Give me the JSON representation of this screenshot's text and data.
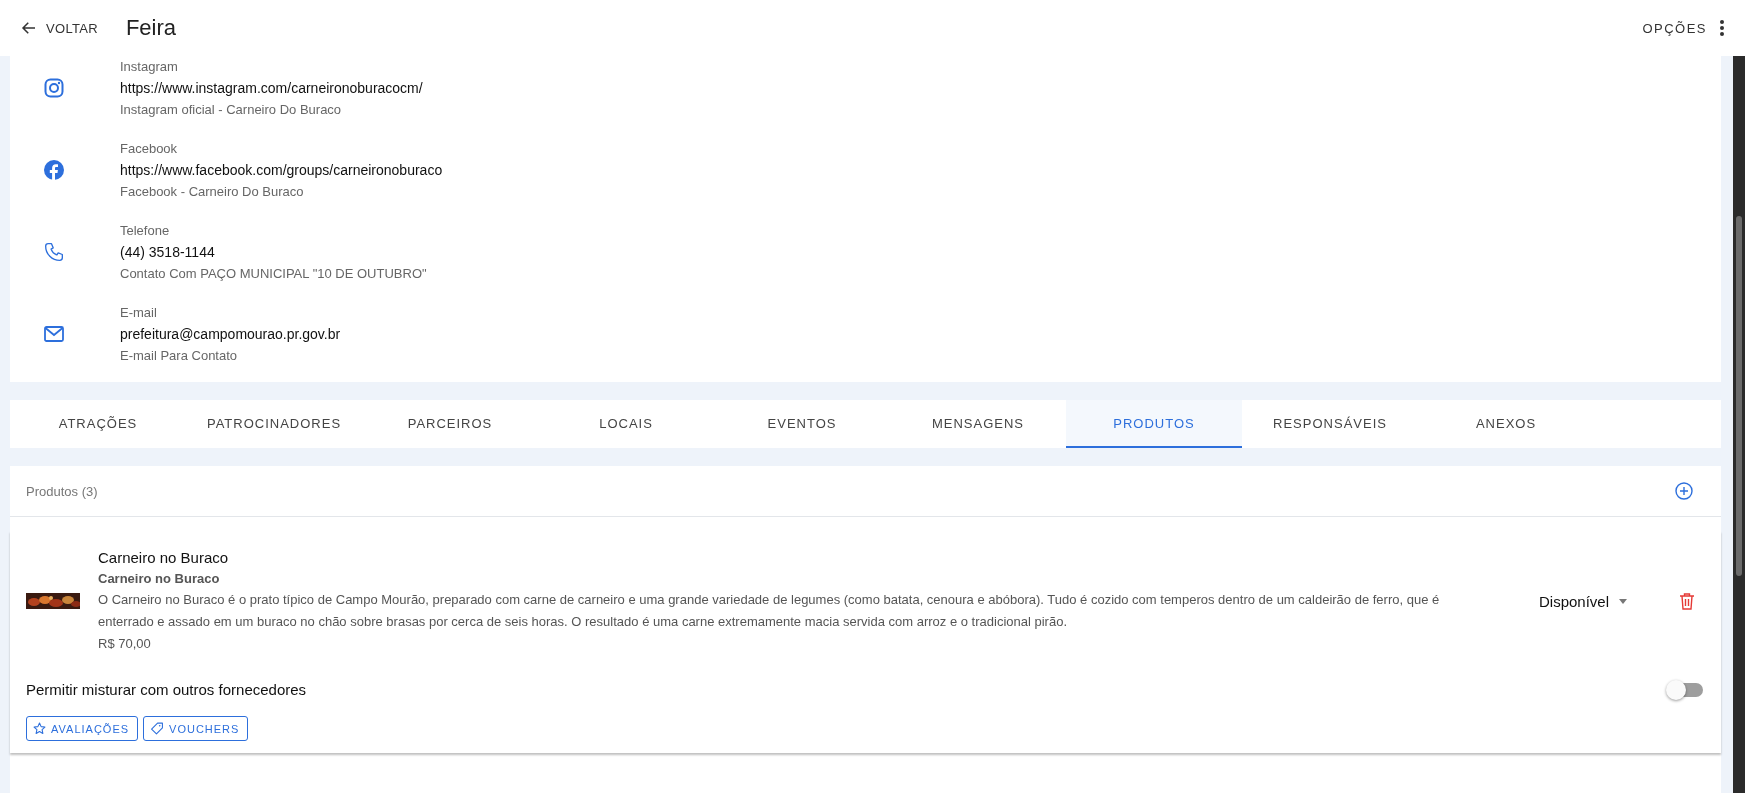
{
  "header": {
    "back_label": "VOLTAR",
    "title": "Feira",
    "options_label": "OPÇÕES"
  },
  "contacts": [
    {
      "kind": "instagram",
      "label": "Instagram",
      "value": "https://www.instagram.com/carneironoburacocm/",
      "description": "Instagram oficial - Carneiro Do Buraco"
    },
    {
      "kind": "facebook",
      "label": "Facebook",
      "value": "https://www.facebook.com/groups/carneironoburaco",
      "description": "Facebook - Carneiro Do Buraco"
    },
    {
      "kind": "phone",
      "label": "Telefone",
      "value": "(44) 3518-1144",
      "description": "Contato Com PAÇO MUNICIPAL \"10 DE OUTUBRO\""
    },
    {
      "kind": "email",
      "label": "E-mail",
      "value": "prefeitura@campomourao.pr.gov.br",
      "description": "E-mail Para Contato"
    }
  ],
  "tabs": [
    {
      "label": "ATRAÇÕES",
      "selected": false
    },
    {
      "label": "PATROCINADORES",
      "selected": false
    },
    {
      "label": "PARCEIROS",
      "selected": false
    },
    {
      "label": "LOCAIS",
      "selected": false
    },
    {
      "label": "EVENTOS",
      "selected": false
    },
    {
      "label": "MENSAGENS",
      "selected": false
    },
    {
      "label": "PRODUTOS",
      "selected": true
    },
    {
      "label": "RESPONSÁVEIS",
      "selected": false
    },
    {
      "label": "ANEXOS",
      "selected": false
    }
  ],
  "products": {
    "header": "Produtos (3)",
    "items": [
      {
        "name": "Carneiro no Buraco",
        "subtitle": "Carneiro no Buraco",
        "description": "O Carneiro no Buraco é o prato típico de Campo Mourão, preparado com carne de carneiro e uma grande variedade de legumes (como batata, cenoura e abóbora). Tudo é cozido com temperos dentro de um caldeirão de ferro, que é enterrado e assado em um buraco no chão sobre brasas por cerca de seis horas. O resultado é uma carne extremamente macia servida com arroz e o tradicional pirão.",
        "price": "R$ 70,00",
        "status": "Disponível",
        "mix_label": "Permitir misturar com outros fornecedores",
        "mix_on": false,
        "buttons": [
          {
            "kind": "reviews",
            "label": "AVALIAÇÕES"
          },
          {
            "kind": "vouchers",
            "label": "VOUCHERS"
          }
        ]
      }
    ]
  }
}
